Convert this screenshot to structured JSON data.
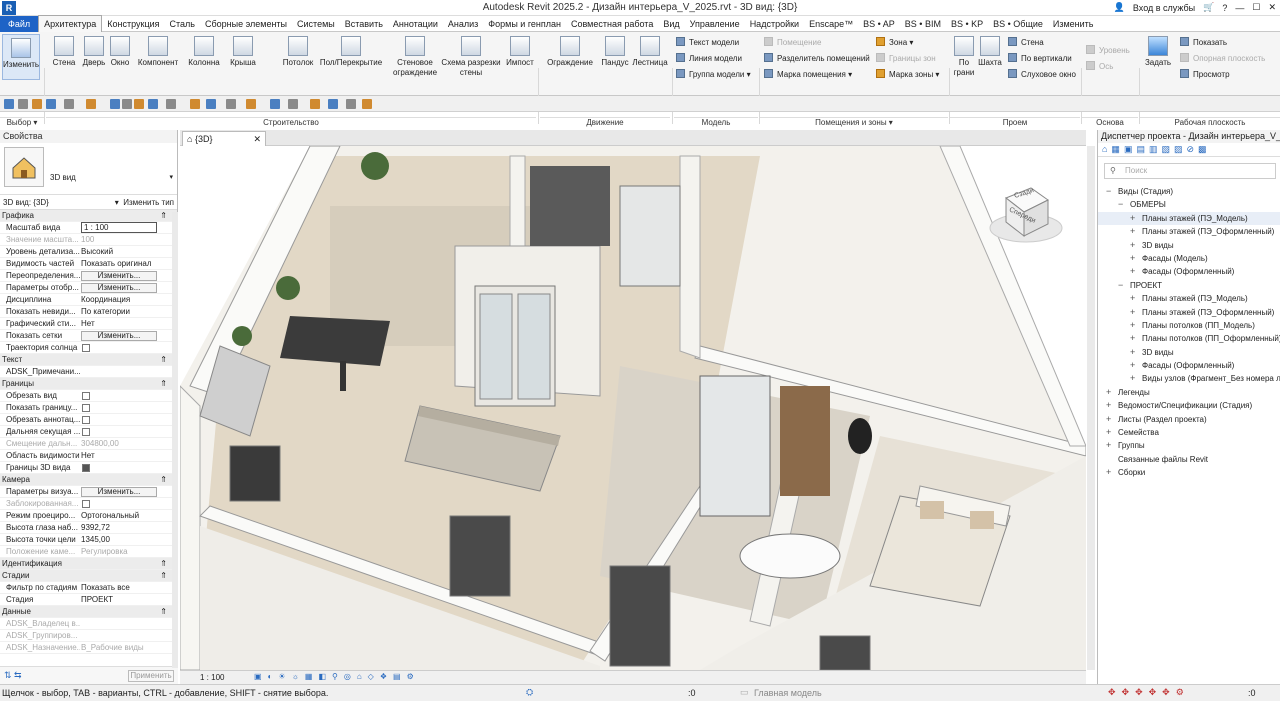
{
  "app": {
    "title": "Autodesk Revit 2025.2 - Дизайн интерьера_V_2025.rvt - 3D вид: {3D}",
    "logo": "R",
    "signin": "Вход в службы",
    "help": "?"
  },
  "menu": [
    "Файл",
    "Архитектура",
    "Конструкция",
    "Сталь",
    "Сборные элементы",
    "Системы",
    "Вставить",
    "Аннотации",
    "Анализ",
    "Формы и генплан",
    "Совместная работа",
    "Вид",
    "Управление",
    "Надстройки",
    "Enscape™",
    "BS • AP",
    "BS • BIM",
    "BS • KP",
    "BS • Общие",
    "Изменить"
  ],
  "ribbon": {
    "modify": "Изменить",
    "select": "Выбор",
    "build": [
      "Стена",
      "Дверь",
      "Окно",
      "Компонент",
      "Колонна",
      "Крыша",
      "Потолок",
      "Пол/Перекрытие",
      "Стеновое ограждение",
      "Схема разрезки стены",
      "Импост"
    ],
    "build_panel": "Строительство",
    "move": [
      "Ограждение",
      "Пандус",
      "Лестница"
    ],
    "move_panel": "Движение",
    "model": [
      "Текст модели",
      "Линия модели",
      "Группа модели"
    ],
    "model_panel": "Модель",
    "rooms": [
      "Помещение",
      "Разделитель помещений",
      "Марка помещения",
      "Зона",
      "Границы зон",
      "Марка зоны"
    ],
    "rooms_panel": "Помещения и зоны",
    "opening_big": [
      "По грани",
      "Шахта"
    ],
    "opening": [
      "Стена",
      "По вертикали",
      "Слуховое окно"
    ],
    "opening_panel": "Проем",
    "datum": [
      "Уровень",
      "Ось"
    ],
    "datum_panel": "Основа",
    "workplane_set": "Задать",
    "workplane": [
      "Показать",
      "Опорная плоскость",
      "Просмотр"
    ],
    "workplane_panel": "Рабочая плоскость"
  },
  "properties": {
    "header": "Свойства",
    "type_name": "3D вид",
    "type_selector": "3D вид: {3D}",
    "edit_type": "Изменить тип",
    "rows": [
      {
        "k": "Графика",
        "group": true
      },
      {
        "k": "Масштаб вида",
        "v": "1 : 100",
        "box": true
      },
      {
        "k": "Значение масшта...",
        "v": "100",
        "dis": true
      },
      {
        "k": "Уровень детализа...",
        "v": "Высокий"
      },
      {
        "k": "Видимость частей",
        "v": "Показать оригинал"
      },
      {
        "k": "Переопределения...",
        "btn": "Изменить..."
      },
      {
        "k": "Параметры отобр...",
        "btn": "Изменить..."
      },
      {
        "k": "Дисциплина",
        "v": "Координация"
      },
      {
        "k": "Показать невиди...",
        "v": "По категории"
      },
      {
        "k": "Графический сти...",
        "v": "Нет"
      },
      {
        "k": "Показать сетки",
        "btn": "Изменить..."
      },
      {
        "k": "Траектория солнца",
        "chk": false
      },
      {
        "k": "Текст",
        "group": true
      },
      {
        "k": "ADSK_Примечани...",
        "v": ""
      },
      {
        "k": "Границы",
        "group": true
      },
      {
        "k": "Обрезать вид",
        "chk": false
      },
      {
        "k": "Показать границу...",
        "chk": false
      },
      {
        "k": "Обрезать аннотац...",
        "chk": false
      },
      {
        "k": "Дальняя секущая ...",
        "chk": false
      },
      {
        "k": "Смещение дальн...",
        "v": "304800,00",
        "dis": true
      },
      {
        "k": "Область видимости",
        "v": "Нет"
      },
      {
        "k": "Границы 3D вида",
        "chk": true
      },
      {
        "k": "Камера",
        "group": true
      },
      {
        "k": "Параметры визуа...",
        "btn": "Изменить..."
      },
      {
        "k": "Заблокированная...",
        "chk": false,
        "dis": true
      },
      {
        "k": "Режим проециро...",
        "v": "Ортогональный"
      },
      {
        "k": "Высота глаза наб...",
        "v": "9392,72"
      },
      {
        "k": "Высота точки цели",
        "v": "1345,00"
      },
      {
        "k": "Положение каме...",
        "v": "Регулировка",
        "dis": true
      },
      {
        "k": "Идентификация",
        "group": true
      },
      {
        "k": "Стадии",
        "group": true
      },
      {
        "k": "Фильтр по стадиям",
        "v": "Показать все"
      },
      {
        "k": "Стадия",
        "v": "ПРОЕКТ"
      },
      {
        "k": "Данные",
        "group": true
      },
      {
        "k": "ADSK_Владелец в...",
        "v": "",
        "dis": true
      },
      {
        "k": "ADSK_Группиров...",
        "v": "",
        "dis": true
      },
      {
        "k": "ADSK_Назначение...",
        "v": "В_Рабочие виды",
        "dis": true
      }
    ],
    "apply": "Применить"
  },
  "view": {
    "tab": "{3D}",
    "scale": "1 : 100",
    "cube_labels": [
      "Сзади",
      "Спереди"
    ]
  },
  "browser": {
    "header": "Диспетчер проекта - Дизайн интерьера_V_2...",
    "search": "Поиск",
    "items": [
      {
        "t": "Виды (Стадия)",
        "lvl": 0,
        "tg": "−"
      },
      {
        "t": "ОБМЕРЫ",
        "lvl": 1,
        "tg": "−"
      },
      {
        "t": "Планы этажей (ПЭ_Модель)",
        "lvl": 2,
        "tg": "+",
        "sel": true
      },
      {
        "t": "Планы этажей (ПЭ_Оформленный)",
        "lvl": 2,
        "tg": "+"
      },
      {
        "t": "3D виды",
        "lvl": 2,
        "tg": "+"
      },
      {
        "t": "Фасады (Модель)",
        "lvl": 2,
        "tg": "+"
      },
      {
        "t": "Фасады (Оформленный)",
        "lvl": 2,
        "tg": "+"
      },
      {
        "t": "ПРОЕКТ",
        "lvl": 1,
        "tg": "−"
      },
      {
        "t": "Планы этажей (ПЭ_Модель)",
        "lvl": 2,
        "tg": "+"
      },
      {
        "t": "Планы этажей (ПЭ_Оформленный)",
        "lvl": 2,
        "tg": "+"
      },
      {
        "t": "Планы потолков (ПП_Модель)",
        "lvl": 2,
        "tg": "+"
      },
      {
        "t": "Планы потолков (ПП_Оформленный)",
        "lvl": 2,
        "tg": "+"
      },
      {
        "t": "3D виды",
        "lvl": 2,
        "tg": "+"
      },
      {
        "t": "Фасады (Оформленный)",
        "lvl": 2,
        "tg": "+"
      },
      {
        "t": "Виды узлов (Фрагмент_Без номера листа)",
        "lvl": 2,
        "tg": "+"
      },
      {
        "t": "Легенды",
        "lvl": 0,
        "tg": "+"
      },
      {
        "t": "Ведомости/Спецификации (Стадия)",
        "lvl": 0,
        "tg": "+"
      },
      {
        "t": "Листы (Раздел проекта)",
        "lvl": 0,
        "tg": "+"
      },
      {
        "t": "Семейства",
        "lvl": 0,
        "tg": "+"
      },
      {
        "t": "Группы",
        "lvl": 0,
        "tg": "+"
      },
      {
        "t": "Связанные файлы Revit",
        "lvl": 0,
        "tg": ""
      },
      {
        "t": "Сборки",
        "lvl": 0,
        "tg": "+"
      }
    ]
  },
  "status": {
    "hint": "Щелчок - выбор, TAB - варианты, CTRL - добавление, SHIFT - снятие выбора.",
    "zero1": ":0",
    "model": "Главная модель",
    "zero2": ":0"
  }
}
